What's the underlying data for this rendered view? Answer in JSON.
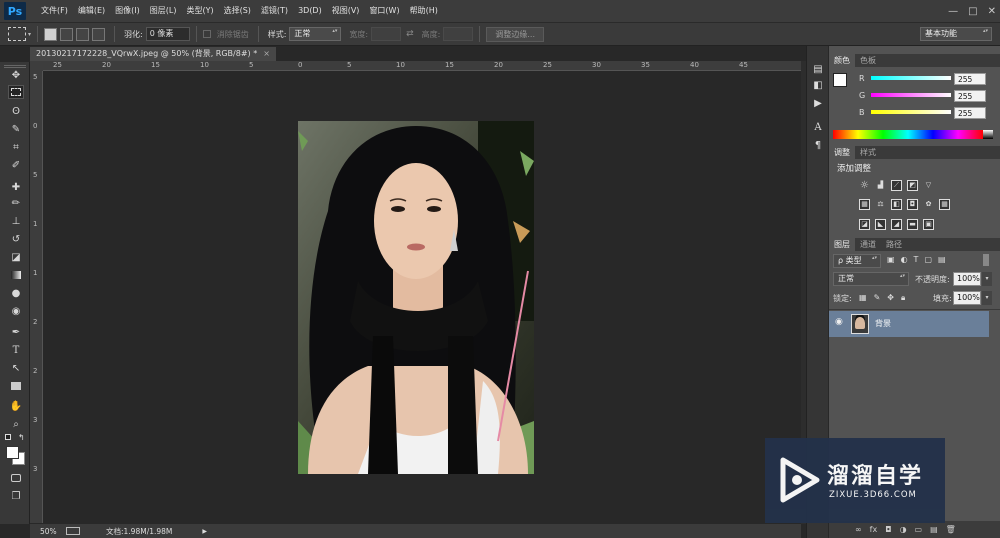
{
  "app": {
    "logo": "Ps",
    "window_controls": {
      "minimize": "—",
      "restore": "□",
      "close": "✕"
    }
  },
  "menu": [
    {
      "label": "文件(F)"
    },
    {
      "label": "编辑(E)"
    },
    {
      "label": "图像(I)"
    },
    {
      "label": "图层(L)"
    },
    {
      "label": "类型(Y)"
    },
    {
      "label": "选择(S)"
    },
    {
      "label": "滤镜(T)"
    },
    {
      "label": "3D(D)"
    },
    {
      "label": "视图(V)"
    },
    {
      "label": "窗口(W)"
    },
    {
      "label": "帮助(H)"
    }
  ],
  "options": {
    "feather_label": "羽化:",
    "feather_value": "0 像素",
    "antialias_label": "消除锯齿",
    "style_label": "样式:",
    "style_value": "正常",
    "width_label": "宽度:",
    "height_label": "高度:",
    "refine_edge": "调整边缘...",
    "workspace": "基本功能"
  },
  "document": {
    "tab_title": "20130217172228_VQrwX.jpeg @ 50% (背景, RGB/8#) *",
    "close": "×"
  },
  "ruler": {
    "top": [
      "25",
      "20",
      "15",
      "10",
      "5",
      "0",
      "5",
      "10",
      "15",
      "20",
      "25",
      "30",
      "35",
      "40",
      "45"
    ],
    "left": [
      "5",
      "0",
      "5",
      "1",
      "1",
      "2",
      "2",
      "3",
      "3"
    ]
  },
  "status": {
    "zoom": "50%",
    "doc_info": "文档:1.98M/1.98M",
    "arrow": "▶"
  },
  "color_panel": {
    "tabs": [
      "颜色",
      "色板"
    ],
    "channels": [
      {
        "label": "R",
        "value": "255"
      },
      {
        "label": "G",
        "value": "255"
      },
      {
        "label": "B",
        "value": "255"
      }
    ]
  },
  "adjust_panel": {
    "tabs": [
      "调整",
      "样式"
    ],
    "title": "添加调整"
  },
  "layers_panel": {
    "tabs": [
      "图层",
      "通道",
      "路径"
    ],
    "filter_value": "ρ 类型",
    "blend_mode": "正常",
    "opacity_label": "不透明度:",
    "opacity_value": "100%",
    "lock_label": "锁定:",
    "fill_label": "填充:",
    "fill_value": "100%",
    "layer_name": "背景",
    "footer_icons": [
      "∞",
      "fx",
      "◘",
      "◑",
      "▭",
      "▤",
      "🗑"
    ]
  },
  "watermark": {
    "brand": "溜溜自学",
    "url": "ZIXUE.3D66.COM"
  }
}
